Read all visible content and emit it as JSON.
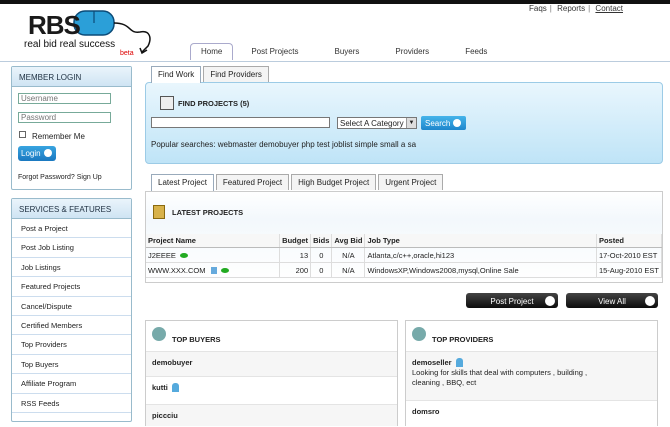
{
  "header": {
    "links": [
      "Faqs",
      "Reports",
      "Contact"
    ],
    "logo_text": "RBS",
    "tagline": "real bid  real success",
    "beta": "beta"
  },
  "nav": {
    "items": [
      "Home",
      "Post Projects",
      "Buyers",
      "Providers",
      "Feeds"
    ]
  },
  "login": {
    "title": "MEMBER LOGIN",
    "username_placeholder": "Username",
    "password_placeholder": "Password",
    "remember": "Remember Me",
    "button": "Login",
    "forgot": "Forgot Password? Sign Up"
  },
  "services": {
    "title": "SERVICES & FEATURES",
    "items": [
      "Post a Project",
      "Post Job Listing",
      "Job Listings",
      "Featured Projects",
      "Cancel/Dispute",
      "Certified Members",
      "Top Providers",
      "Top Buyers",
      "Affiliate Program",
      "RSS Feeds"
    ]
  },
  "find": {
    "tabs": [
      "Find Work",
      "Find Providers"
    ],
    "title": "FIND PROJECTS (5)",
    "category": "Select A Category",
    "search": "Search",
    "popular_label": "Popular searches:",
    "popular": "webmaster demobuyer php test joblist simple small a sa"
  },
  "projects": {
    "tabs": [
      "Latest Project",
      "Featured Project",
      "High Budget Project",
      "Urgent Project"
    ],
    "title": "LATEST PROJECTS",
    "columns": [
      "Project Name",
      "Budget",
      "Bids",
      "Avg Bid",
      "Job Type",
      "Posted"
    ],
    "rows": [
      [
        "J2EEEE",
        "13",
        "0",
        "N/A",
        "Atlanta,c/c++,oracle,hi123",
        "17-Oct-2010 EST"
      ],
      [
        "WWW.XXX.COM",
        "200",
        "0",
        "N/A",
        "WindowsXP,Windows2008,mysql,Online Sale",
        "15-Aug-2010 EST"
      ]
    ],
    "post_button": "Post Project",
    "view_button": "View All"
  },
  "buyers": {
    "title": "TOP BUYERS",
    "items": [
      "demobuyer",
      "kutti",
      "piccciu"
    ]
  },
  "providers": {
    "title": "TOP PROVIDERS",
    "items": [
      {
        "name": "demoseller",
        "desc": "Looking for skills that deal with computers , building , cleaning , BBQ, ect"
      },
      {
        "name": "domsro",
        "desc": ""
      }
    ]
  }
}
